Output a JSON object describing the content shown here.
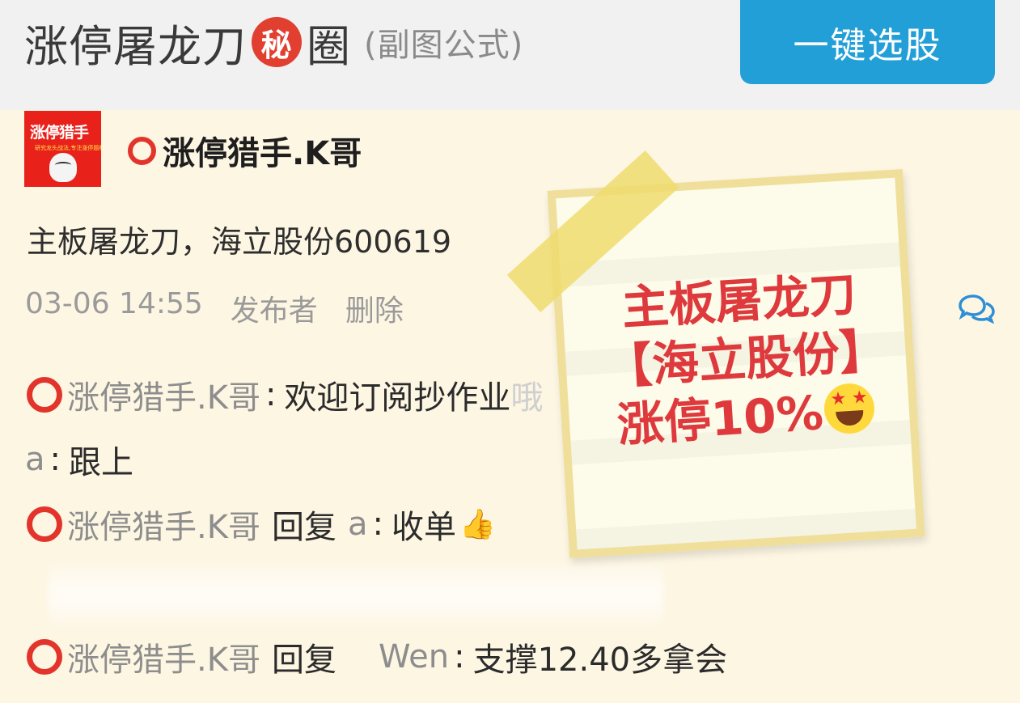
{
  "header": {
    "title_part1": "涨停屠龙刀",
    "badge": "秘",
    "title_part2": "圈",
    "subtitle": "(副图公式)",
    "select_button": "一键选股"
  },
  "avatar": {
    "title": "涨停猎手",
    "tagline": "研究龙头战法,专注涨停题材"
  },
  "post": {
    "author": "涨停猎手.K哥",
    "text": "主板屠龙刀，海立股份600619",
    "timestamp": "03-06 14:55",
    "publisher_label": "发布者",
    "delete_label": "删除"
  },
  "note": {
    "line1": "主板屠龙刀",
    "line2": "【海立股份】",
    "line3": "涨停10%"
  },
  "comments": [
    {
      "author": "涨停猎手.K哥",
      "text": "欢迎订阅抄作业",
      "trail": "哦"
    },
    {
      "author": "a",
      "text": "跟上"
    },
    {
      "author": "涨停猎手.K哥",
      "reply_label": "回复",
      "reply_to": "a",
      "text": "收单"
    },
    {
      "author": "涨停猎手.K哥",
      "reply_label": "回复",
      "reply_to": "Wen",
      "text": "支撑12.40多拿会"
    }
  ],
  "colors": {
    "accent_blue": "#239fd8",
    "note_red": "#de3a3d",
    "ring_red": "#e2342b",
    "background": "#fdf6e3"
  },
  "icons": [
    "ring-icon",
    "comment-icon",
    "thumbs-up-icon",
    "star-struck-emoji"
  ]
}
